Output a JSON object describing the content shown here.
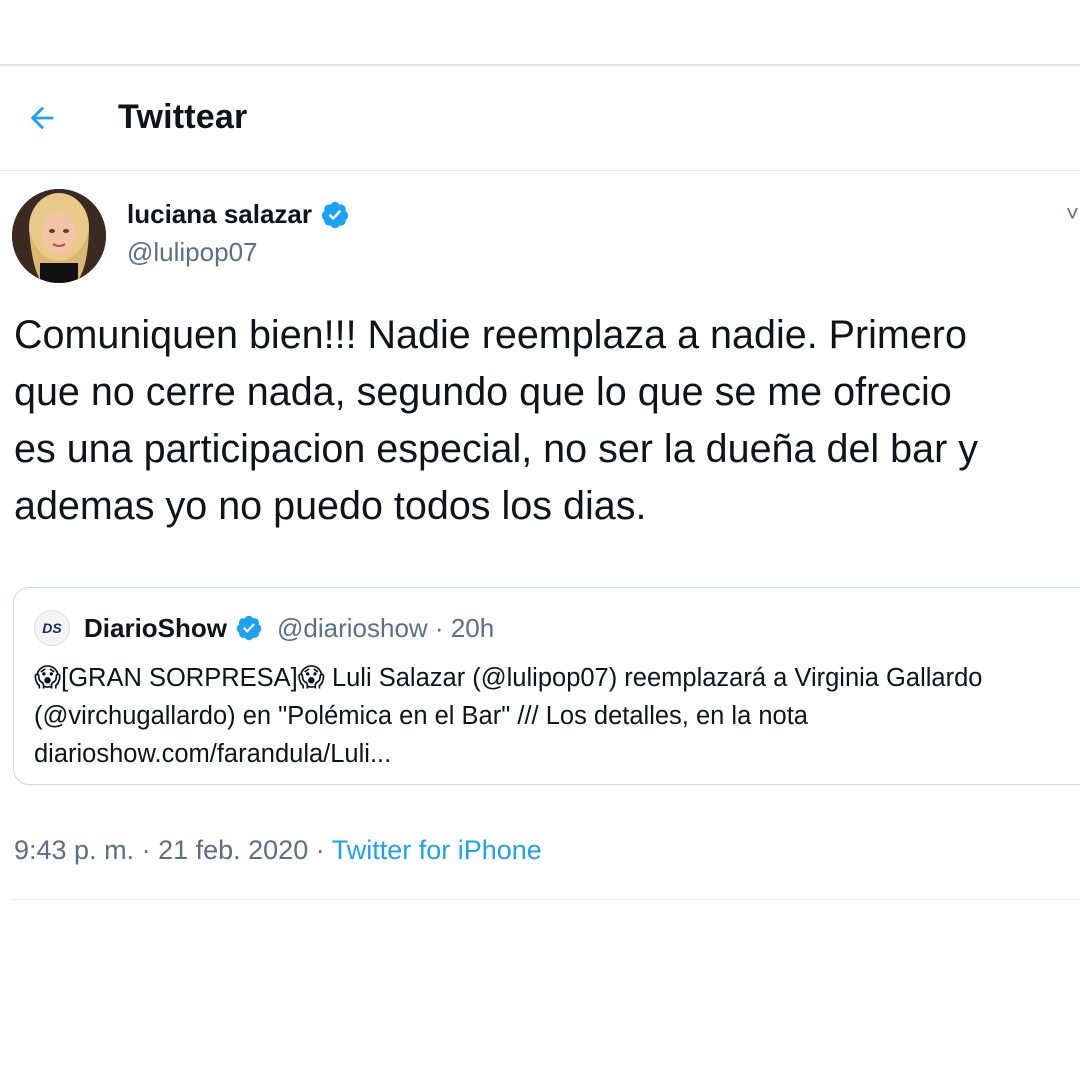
{
  "header": {
    "title": "Twittear"
  },
  "tweet": {
    "author_name": "luciana salazar",
    "author_handle": "@lulipop07",
    "text": "Comuniquen bien!!! Nadie reemplaza a nadie. Primero\nque no cerre nada, segundo que lo que se me ofrecio\nes una participacion especial, no ser la dueña del bar y\nademas yo no puedo todos los dias.",
    "time": "9:43 p. m.",
    "separator": " · ",
    "date": "21 feb. 2020",
    "source": "Twitter for iPhone"
  },
  "quote": {
    "logo_text": "DS",
    "name": "DiarioShow",
    "handle": "@diarioshow",
    "age": "20h",
    "line1_a": "[GRAN SORPRESA]",
    "line1_b": " Luli Salazar (@lulipop07) reemplazará a Virginia Gallardo",
    "line2": "(@virchugallardo) en \"Polémica en el Bar\" /// Los detalles, en la nota",
    "line3": "diarioshow.com/farandula/Luli..."
  },
  "colors": {
    "accent": "#1da1f2",
    "verified": "#1da1f2",
    "secondary_text": "#5b7083",
    "border": "#ccd6dd"
  },
  "icons": {
    "back": "arrow-left-icon",
    "verified": "verified-badge-icon",
    "more": "chevron-down-icon",
    "emoji": "screaming-face-emoji"
  }
}
